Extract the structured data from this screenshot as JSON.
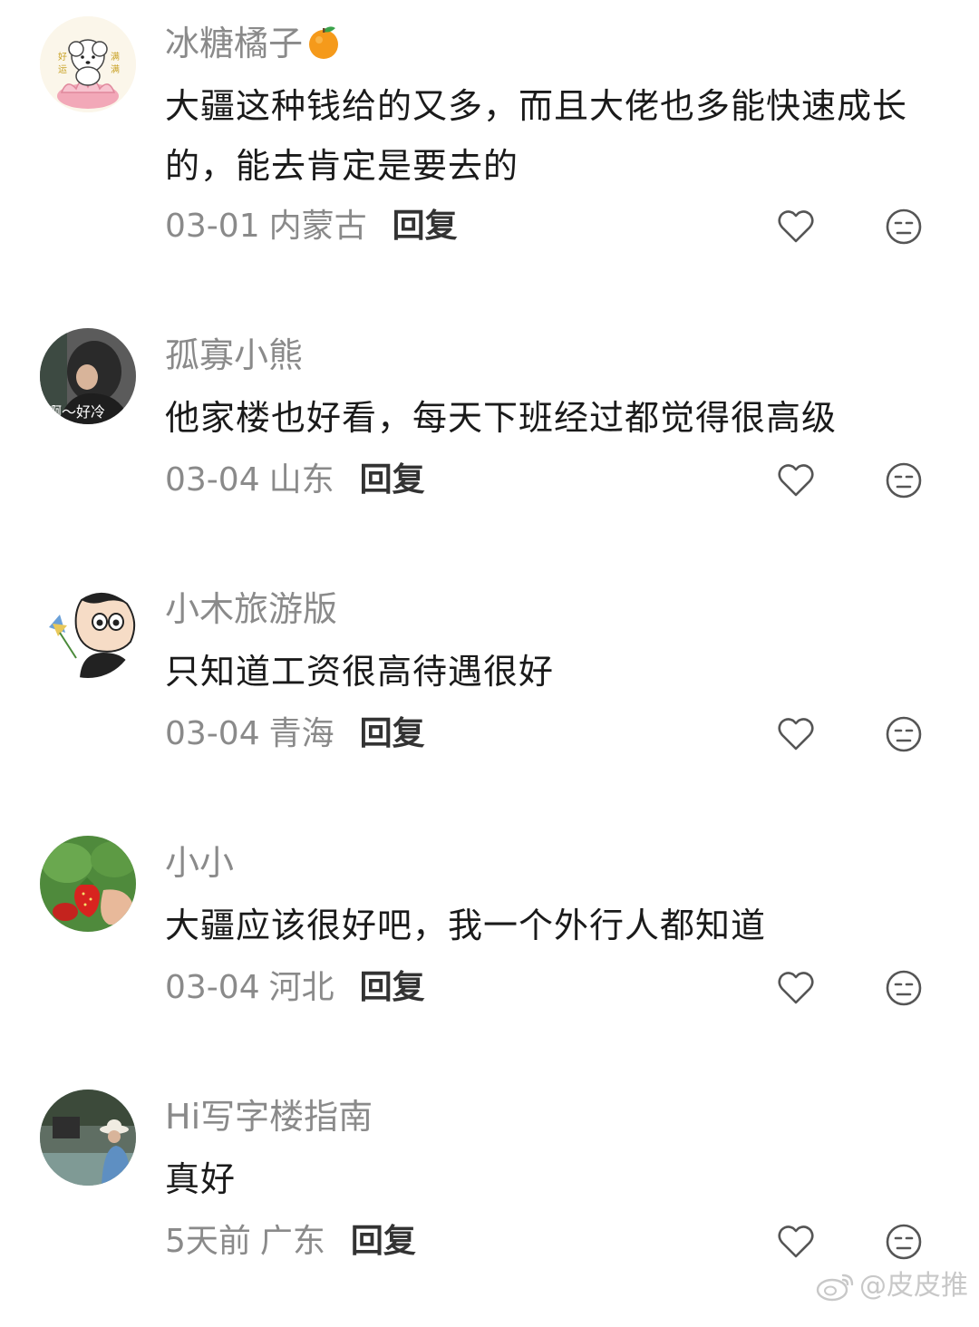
{
  "comments": [
    {
      "username": "冰糖橘子",
      "username_emoji": "orange-emoji",
      "text": "大疆这种钱给的又多，而且大佬也多能快速成长的，能去肯定是要去的",
      "date": "03-01",
      "region": "内蒙古",
      "reply_label": "回复",
      "avatar_text": [
        "好运",
        "满满"
      ]
    },
    {
      "username": "孤寡小熊",
      "text": "他家楼也好看，每天下班经过都觉得很高级",
      "date": "03-04",
      "region": "山东",
      "reply_label": "回复",
      "avatar_text": [
        "啊～好冷"
      ]
    },
    {
      "username": "小木旅游版",
      "text": "只知道工资很高待遇很好",
      "date": "03-04",
      "region": "青海",
      "reply_label": "回复"
    },
    {
      "username": "小小",
      "text": "大疆应该很好吧，我一个外行人都知道",
      "date": "03-04",
      "region": "河北",
      "reply_label": "回复"
    },
    {
      "username": "Hi写字楼指南",
      "text": "真好",
      "date": "5天前",
      "region": "广东",
      "reply_label": "回复"
    }
  ],
  "icons": {
    "like": "heart-outline-icon",
    "dislike": "neutral-face-icon"
  },
  "watermark": {
    "text": "@皮皮推",
    "icon": "weibo-logo-icon"
  },
  "colors": {
    "username": "#8a8a8a",
    "text": "#1a1a1a",
    "meta": "#8a8a8a",
    "reply": "#333333",
    "icon": "#555555"
  }
}
